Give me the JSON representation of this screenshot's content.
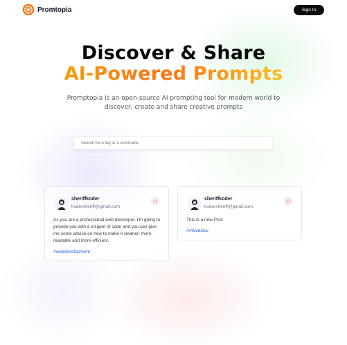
{
  "nav": {
    "brand": "Promtopia",
    "sign_in_label": "Sign In"
  },
  "hero": {
    "title_line1": "Discover & Share",
    "title_line2": "AI-Powered Prompts",
    "subtitle": "Promptopia is an open-source AI prompting tool for modern world to discover, create and share creative prompts"
  },
  "search": {
    "placeholder": "Search for a tag or a username",
    "value": ""
  },
  "prompts": [
    {
      "username": "sheriffkoder",
      "email": "kodersheriff@gmail.com",
      "text": "As you are a professional web developer. I'm going to provide you with a snippet of code and you can give me some advice on how to make it cleaner, more readable and more efficient.",
      "tag": "#webdevelopment"
    },
    {
      "username": "sheriffkoder",
      "email": "kodersheriff@gmail.com",
      "text": "This is a new Post",
      "tag": "##WebDev"
    }
  ],
  "colors": {
    "brand_gradient": [
      "#f59e0b",
      "#f97316",
      "#fbbf24"
    ],
    "button": "#0b0b0b",
    "tag": "#2563eb",
    "logo": "#f97316"
  },
  "icons": {
    "logo": "logo-icon",
    "avatar": "avatar",
    "copy": "copy-icon"
  }
}
